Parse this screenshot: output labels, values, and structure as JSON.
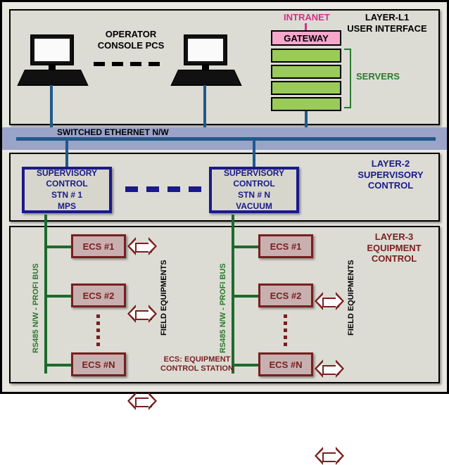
{
  "layer1": {
    "title": "LAYER-L1\nUSER INTERFACE",
    "console_label": "OPERATOR\nCONSOLE PCS",
    "intranet": "INTRANET",
    "gateway": "GATEWAY",
    "servers": "SERVERS",
    "ethernet": "SWITCHED ETHERNET N/W"
  },
  "layer2": {
    "title": "LAYER-2\nSUPERVISORY\nCONTROL",
    "station1": "SUPERVISORY\nCONTROL\nSTN # 1\nMPS",
    "stationN": "SUPERVISORY\nCONTROL\nSTN # N\nVACUUM"
  },
  "layer3": {
    "title": "LAYER-3\nEQUIPMENT\nCONTROL",
    "ecs1": "ECS #1",
    "ecs2": "ECS #2",
    "ecsN": "ECS #N",
    "bus": "RS485 N/W - PROFI BUS",
    "field": "FIELD EQUIPMENTS",
    "legend": "ECS: EQUIPMENT\nCONTROL STATION"
  }
}
